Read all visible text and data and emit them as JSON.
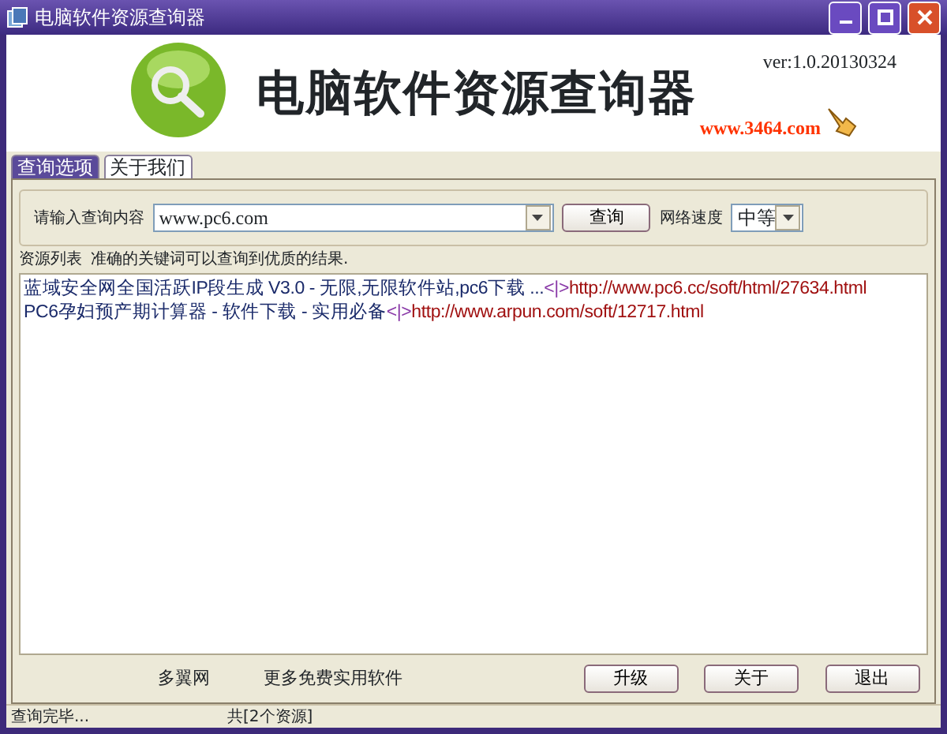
{
  "window": {
    "title": "电脑软件资源查询器"
  },
  "header": {
    "title": "电脑软件资源查询器",
    "version": "ver:1.0.20130324",
    "site": "www.3464.com"
  },
  "tabs": [
    {
      "label": "查询选项",
      "selected": true
    },
    {
      "label": "关于我们",
      "selected": false
    }
  ],
  "search": {
    "label": "请输入查询内容",
    "value": "www.pc6.com",
    "button": "查询",
    "speed_label": "网络速度",
    "speed_value": "中等"
  },
  "results": {
    "legend": "资源列表",
    "hint": "准确的关键词可以查询到优质的结果.",
    "rows": [
      {
        "title": "蓝域安全网全国活跃IP段生成 V3.0 - 无限,无限软件站,pc6下载 ...",
        "separator": "<|>",
        "url": "http://www.pc6.cc/soft/html/27634.html"
      },
      {
        "title": "PC6孕妇预产期计算器 - 软件下载 - 实用必备",
        "separator": "<|>",
        "url": "http://www.arpun.com/soft/12717.html"
      }
    ]
  },
  "footer_links": [
    "多翼网",
    "更多免费实用软件"
  ],
  "buttons": [
    "升级",
    "关于",
    "退出"
  ],
  "status_bar": [
    "查询完毕...",
    "共[2个资源]"
  ]
}
